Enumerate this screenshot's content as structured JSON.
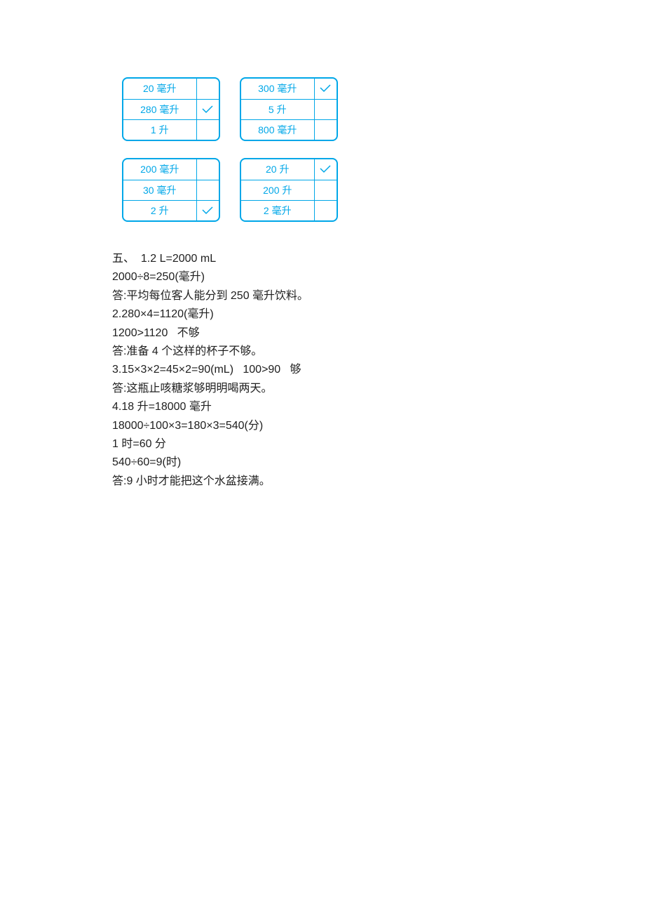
{
  "tables": [
    [
      {
        "rows": [
          {
            "label": "20 毫升",
            "mark": ""
          },
          {
            "label": "280 毫升",
            "mark": "check"
          },
          {
            "label": "1 升",
            "mark": ""
          }
        ]
      },
      {
        "rows": [
          {
            "label": "300 毫升",
            "mark": "check"
          },
          {
            "label": "5 升",
            "mark": ""
          },
          {
            "label": "800 毫升",
            "mark": ""
          }
        ]
      }
    ],
    [
      {
        "rows": [
          {
            "label": "200 毫升",
            "mark": ""
          },
          {
            "label": "30 毫升",
            "mark": ""
          },
          {
            "label": "2 升",
            "mark": "check"
          }
        ]
      },
      {
        "rows": [
          {
            "label": "20 升",
            "mark": "check"
          },
          {
            "label": "200 升",
            "mark": ""
          },
          {
            "label": "2 毫升",
            "mark": ""
          }
        ]
      }
    ]
  ],
  "text_lines": [
    "五、  1.2 L=2000 mL",
    "2000÷8=250(毫升)",
    "答:平均每位客人能分到 250 毫升饮料。",
    "2.280×4=1120(毫升)",
    "1200>1120   不够",
    "答:准备 4 个这样的杯子不够。",
    "3.15×3×2=45×2=90(mL)   100>90   够",
    "答:这瓶止咳糖浆够明明喝两天。",
    "4.18 升=18000 毫升",
    "18000÷100×3=180×3=540(分)",
    "1 时=60 分",
    "540÷60=9(时)",
    "答:9 小时才能把这个水盆接满。"
  ],
  "check_svg_color": "#00A7E8"
}
